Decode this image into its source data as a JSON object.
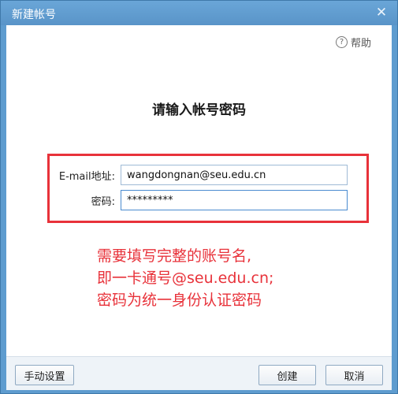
{
  "window": {
    "title": "新建帐号",
    "close_symbol": "✕"
  },
  "help": {
    "icon": "?",
    "label": "帮助"
  },
  "heading": "请输入帐号密码",
  "form": {
    "email_label": "E-mail地址:",
    "email_value": "wangdongnan@seu.edu.cn",
    "password_label": "密码:",
    "password_value": "*********"
  },
  "annotation": {
    "lines": [
      "需要填写完整的账号名,",
      "即一卡通号@seu.edu.cn;",
      "密码为统一身份认证密码"
    ]
  },
  "footer": {
    "manual_settings": "手动设置",
    "create": "创建",
    "cancel": "取消"
  },
  "colors": {
    "titlebar": "#5e9ccf",
    "annotation": "#e8323a"
  }
}
